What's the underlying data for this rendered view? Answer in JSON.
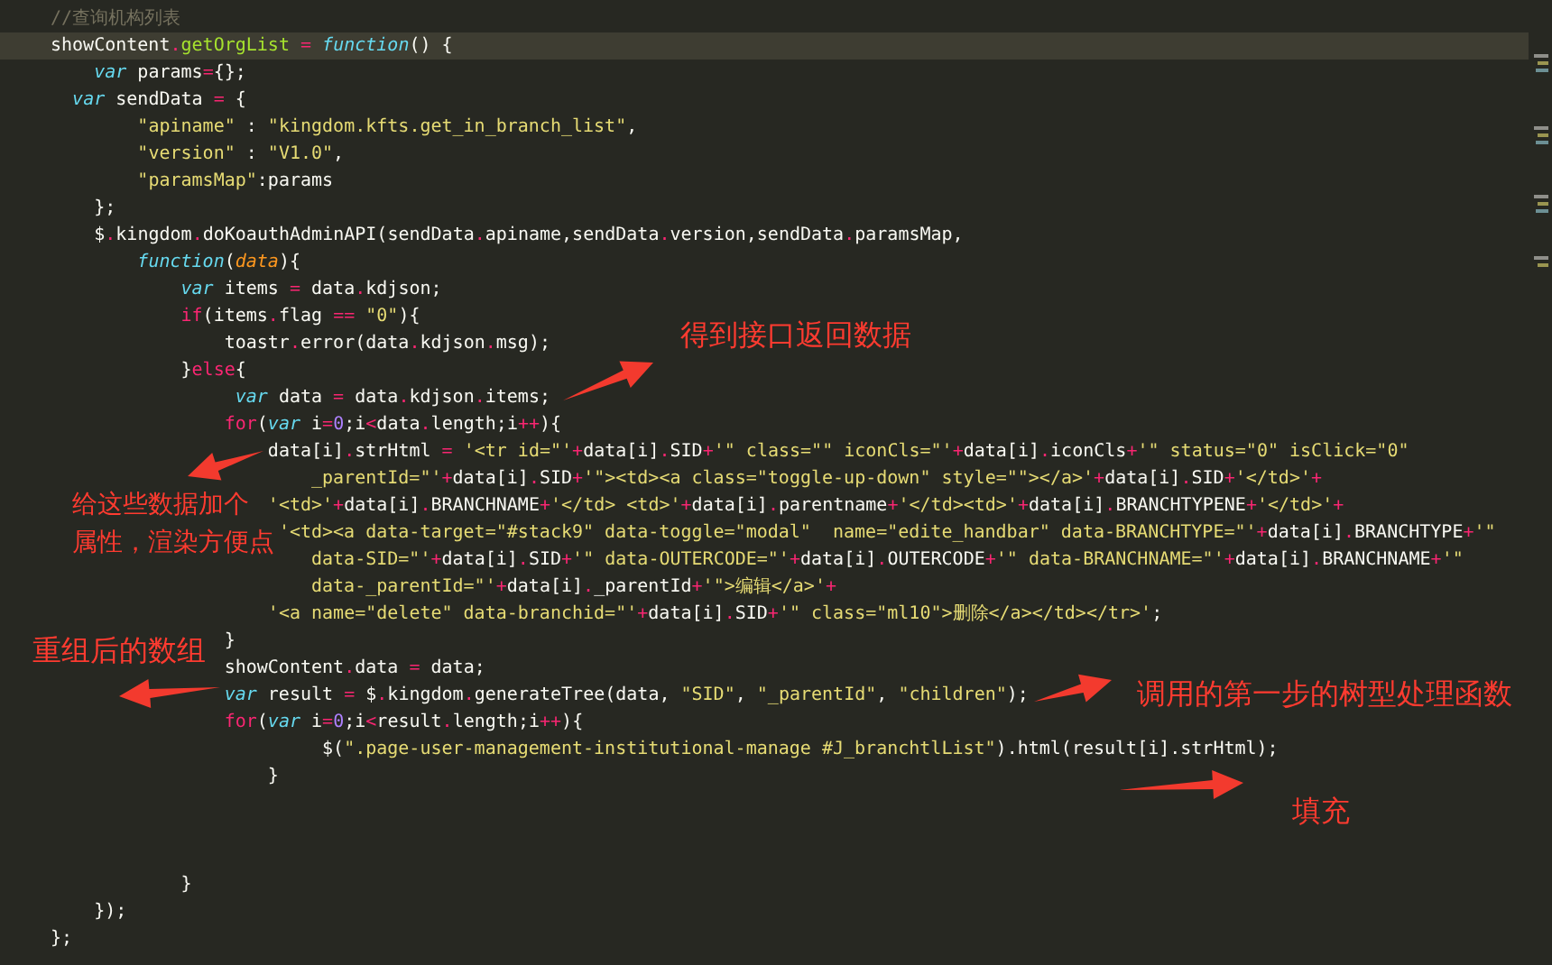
{
  "editor": {
    "lines": [
      {
        "current": false,
        "tokens": [
          {
            "kind": "comment",
            "text": "//查询机构列表"
          }
        ]
      },
      {
        "current": true,
        "tokens": [
          {
            "kind": "plain",
            "text": "showContent"
          },
          {
            "kind": "op",
            "text": "."
          },
          {
            "kind": "func",
            "text": "getOrgList"
          },
          {
            "kind": "op",
            "text": " = "
          },
          {
            "kind": "storage",
            "text": "function"
          },
          {
            "kind": "plain",
            "text": "() {"
          }
        ]
      },
      {
        "current": false,
        "tokens": [
          {
            "kind": "storage",
            "text": "    var"
          },
          {
            "kind": "plain",
            "text": " params"
          },
          {
            "kind": "op",
            "text": "="
          },
          {
            "kind": "plain",
            "text": "{};"
          }
        ]
      },
      {
        "current": false,
        "tokens": [
          {
            "kind": "storage",
            "text": "  var"
          },
          {
            "kind": "plain",
            "text": " sendData "
          },
          {
            "kind": "op",
            "text": "="
          },
          {
            "kind": "plain",
            "text": " {"
          }
        ]
      },
      {
        "current": false,
        "tokens": [
          {
            "kind": "string",
            "text": "        \"apiname\""
          },
          {
            "kind": "plain",
            "text": " : "
          },
          {
            "kind": "string",
            "text": "\"kingdom.kfts.get_in_branch_list\""
          },
          {
            "kind": "plain",
            "text": ","
          }
        ]
      },
      {
        "current": false,
        "tokens": [
          {
            "kind": "string",
            "text": "        \"version\""
          },
          {
            "kind": "plain",
            "text": " : "
          },
          {
            "kind": "string",
            "text": "\"V1.0\""
          },
          {
            "kind": "plain",
            "text": ","
          }
        ]
      },
      {
        "current": false,
        "tokens": [
          {
            "kind": "string",
            "text": "        \"paramsMap\""
          },
          {
            "kind": "plain",
            "text": ":params"
          }
        ]
      },
      {
        "current": false,
        "tokens": [
          {
            "kind": "plain",
            "text": "    };"
          }
        ]
      },
      {
        "current": false,
        "tokens": [
          {
            "kind": "plain",
            "text": "    $"
          },
          {
            "kind": "op",
            "text": "."
          },
          {
            "kind": "plain",
            "text": "kingdom"
          },
          {
            "kind": "op",
            "text": "."
          },
          {
            "kind": "plain",
            "text": "doKoauthAdminAPI(sendData"
          },
          {
            "kind": "op",
            "text": "."
          },
          {
            "kind": "plain",
            "text": "apiname,sendData"
          },
          {
            "kind": "op",
            "text": "."
          },
          {
            "kind": "plain",
            "text": "version,sendData"
          },
          {
            "kind": "op",
            "text": "."
          },
          {
            "kind": "plain",
            "text": "paramsMap,"
          }
        ]
      },
      {
        "current": false,
        "tokens": [
          {
            "kind": "storage",
            "text": "        function"
          },
          {
            "kind": "plain",
            "text": "("
          },
          {
            "kind": "param",
            "text": "data"
          },
          {
            "kind": "plain",
            "text": "){"
          }
        ]
      },
      {
        "current": false,
        "tokens": [
          {
            "kind": "storage",
            "text": "            var"
          },
          {
            "kind": "plain",
            "text": " items "
          },
          {
            "kind": "op",
            "text": "="
          },
          {
            "kind": "plain",
            "text": " data"
          },
          {
            "kind": "op",
            "text": "."
          },
          {
            "kind": "plain",
            "text": "kdjson;"
          }
        ]
      },
      {
        "current": false,
        "tokens": [
          {
            "kind": "keyword",
            "text": "            if"
          },
          {
            "kind": "plain",
            "text": "(items"
          },
          {
            "kind": "op",
            "text": "."
          },
          {
            "kind": "plain",
            "text": "flag "
          },
          {
            "kind": "op",
            "text": "== "
          },
          {
            "kind": "string",
            "text": "\"0\""
          },
          {
            "kind": "plain",
            "text": "){"
          }
        ]
      },
      {
        "current": false,
        "tokens": [
          {
            "kind": "plain",
            "text": "                toastr"
          },
          {
            "kind": "op",
            "text": "."
          },
          {
            "kind": "plain",
            "text": "error(data"
          },
          {
            "kind": "op",
            "text": "."
          },
          {
            "kind": "plain",
            "text": "kdjson"
          },
          {
            "kind": "op",
            "text": "."
          },
          {
            "kind": "plain",
            "text": "msg);"
          }
        ]
      },
      {
        "current": false,
        "tokens": [
          {
            "kind": "plain",
            "text": "            }"
          },
          {
            "kind": "keyword",
            "text": "else"
          },
          {
            "kind": "plain",
            "text": "{"
          }
        ]
      },
      {
        "current": false,
        "tokens": [
          {
            "kind": "storage",
            "text": "                 var"
          },
          {
            "kind": "plain",
            "text": " data "
          },
          {
            "kind": "op",
            "text": "="
          },
          {
            "kind": "plain",
            "text": " data"
          },
          {
            "kind": "op",
            "text": "."
          },
          {
            "kind": "plain",
            "text": "kdjson"
          },
          {
            "kind": "op",
            "text": "."
          },
          {
            "kind": "plain",
            "text": "items;"
          }
        ]
      },
      {
        "current": false,
        "tokens": [
          {
            "kind": "keyword",
            "text": "                for"
          },
          {
            "kind": "plain",
            "text": "("
          },
          {
            "kind": "storage",
            "text": "var"
          },
          {
            "kind": "plain",
            "text": " i"
          },
          {
            "kind": "op",
            "text": "="
          },
          {
            "kind": "number",
            "text": "0"
          },
          {
            "kind": "plain",
            "text": ";i"
          },
          {
            "kind": "op",
            "text": "<"
          },
          {
            "kind": "plain",
            "text": "data"
          },
          {
            "kind": "op",
            "text": "."
          },
          {
            "kind": "plain",
            "text": "length;i"
          },
          {
            "kind": "op",
            "text": "++"
          },
          {
            "kind": "plain",
            "text": "){"
          }
        ]
      },
      {
        "current": false,
        "tokens": [
          {
            "kind": "plain",
            "text": "                    data[i]"
          },
          {
            "kind": "op",
            "text": "."
          },
          {
            "kind": "plain",
            "text": "strHtml "
          },
          {
            "kind": "op",
            "text": "= "
          },
          {
            "kind": "string",
            "text": "'<tr id=\"'"
          },
          {
            "kind": "op",
            "text": "+"
          },
          {
            "kind": "plain",
            "text": "data[i]"
          },
          {
            "kind": "op",
            "text": "."
          },
          {
            "kind": "plain",
            "text": "SID"
          },
          {
            "kind": "op",
            "text": "+"
          },
          {
            "kind": "string",
            "text": "'\" class=\"\" iconCls=\"'"
          },
          {
            "kind": "op",
            "text": "+"
          },
          {
            "kind": "plain",
            "text": "data[i]"
          },
          {
            "kind": "op",
            "text": "."
          },
          {
            "kind": "plain",
            "text": "iconCls"
          },
          {
            "kind": "op",
            "text": "+"
          },
          {
            "kind": "string",
            "text": "'\" status=\"0\" isClick=\"0\""
          }
        ]
      },
      {
        "current": false,
        "tokens": [
          {
            "kind": "string",
            "text": "                        _parentId=\"'"
          },
          {
            "kind": "op",
            "text": "+"
          },
          {
            "kind": "plain",
            "text": "data[i]"
          },
          {
            "kind": "op",
            "text": "."
          },
          {
            "kind": "plain",
            "text": "SID"
          },
          {
            "kind": "op",
            "text": "+"
          },
          {
            "kind": "string",
            "text": "'\"><td><a class=\"toggle-up-down\" style=\"\"></a>'"
          },
          {
            "kind": "op",
            "text": "+"
          },
          {
            "kind": "plain",
            "text": "data[i]"
          },
          {
            "kind": "op",
            "text": "."
          },
          {
            "kind": "plain",
            "text": "SID"
          },
          {
            "kind": "op",
            "text": "+"
          },
          {
            "kind": "string",
            "text": "'</td>'"
          },
          {
            "kind": "op",
            "text": "+"
          }
        ]
      },
      {
        "current": false,
        "tokens": [
          {
            "kind": "string",
            "text": "                    '<td>'"
          },
          {
            "kind": "op",
            "text": "+"
          },
          {
            "kind": "plain",
            "text": "data[i]"
          },
          {
            "kind": "op",
            "text": "."
          },
          {
            "kind": "plain",
            "text": "BRANCHNAME"
          },
          {
            "kind": "op",
            "text": "+"
          },
          {
            "kind": "string",
            "text": "'</td> <td>'"
          },
          {
            "kind": "op",
            "text": "+"
          },
          {
            "kind": "plain",
            "text": "data[i]"
          },
          {
            "kind": "op",
            "text": "."
          },
          {
            "kind": "plain",
            "text": "parentname"
          },
          {
            "kind": "op",
            "text": "+"
          },
          {
            "kind": "string",
            "text": "'</td><td>'"
          },
          {
            "kind": "op",
            "text": "+"
          },
          {
            "kind": "plain",
            "text": "data[i]"
          },
          {
            "kind": "op",
            "text": "."
          },
          {
            "kind": "plain",
            "text": "BRANCHTYPENE"
          },
          {
            "kind": "op",
            "text": "+"
          },
          {
            "kind": "string",
            "text": "'</td>'"
          },
          {
            "kind": "op",
            "text": "+"
          }
        ]
      },
      {
        "current": false,
        "tokens": [
          {
            "kind": "string",
            "text": "                     '<td><a data-target=\"#stack9\" data-toggle=\"modal\"  name=\"edite_handbar\" data-BRANCHTYPE=\"'"
          },
          {
            "kind": "op",
            "text": "+"
          },
          {
            "kind": "plain",
            "text": "data[i]"
          },
          {
            "kind": "op",
            "text": "."
          },
          {
            "kind": "plain",
            "text": "BRANCHTYPE"
          },
          {
            "kind": "op",
            "text": "+"
          },
          {
            "kind": "string",
            "text": "'\""
          }
        ]
      },
      {
        "current": false,
        "tokens": [
          {
            "kind": "string",
            "text": "                        data-SID=\"'"
          },
          {
            "kind": "op",
            "text": "+"
          },
          {
            "kind": "plain",
            "text": "data[i]"
          },
          {
            "kind": "op",
            "text": "."
          },
          {
            "kind": "plain",
            "text": "SID"
          },
          {
            "kind": "op",
            "text": "+"
          },
          {
            "kind": "string",
            "text": "'\" data-OUTERCODE=\"'"
          },
          {
            "kind": "op",
            "text": "+"
          },
          {
            "kind": "plain",
            "text": "data[i]"
          },
          {
            "kind": "op",
            "text": "."
          },
          {
            "kind": "plain",
            "text": "OUTERCODE"
          },
          {
            "kind": "op",
            "text": "+"
          },
          {
            "kind": "string",
            "text": "'\" data-BRANCHNAME=\"'"
          },
          {
            "kind": "op",
            "text": "+"
          },
          {
            "kind": "plain",
            "text": "data[i]"
          },
          {
            "kind": "op",
            "text": "."
          },
          {
            "kind": "plain",
            "text": "BRANCHNAME"
          },
          {
            "kind": "op",
            "text": "+"
          },
          {
            "kind": "string",
            "text": "'\""
          }
        ]
      },
      {
        "current": false,
        "tokens": [
          {
            "kind": "string",
            "text": "                        data-_parentId=\"'"
          },
          {
            "kind": "op",
            "text": "+"
          },
          {
            "kind": "plain",
            "text": "data[i]"
          },
          {
            "kind": "op",
            "text": "."
          },
          {
            "kind": "plain",
            "text": "_parentId"
          },
          {
            "kind": "op",
            "text": "+"
          },
          {
            "kind": "string",
            "text": "'\">编辑</a>'"
          },
          {
            "kind": "op",
            "text": "+"
          }
        ]
      },
      {
        "current": false,
        "tokens": [
          {
            "kind": "string",
            "text": "                    '<a name=\"delete\" data-branchid=\"'"
          },
          {
            "kind": "op",
            "text": "+"
          },
          {
            "kind": "plain",
            "text": "data[i]"
          },
          {
            "kind": "op",
            "text": "."
          },
          {
            "kind": "plain",
            "text": "SID"
          },
          {
            "kind": "op",
            "text": "+"
          },
          {
            "kind": "string",
            "text": "'\" class=\"ml10\">删除</a></td></tr>'"
          },
          {
            "kind": "plain",
            "text": ";"
          }
        ]
      },
      {
        "current": false,
        "tokens": [
          {
            "kind": "plain",
            "text": "                }"
          }
        ]
      },
      {
        "current": false,
        "tokens": [
          {
            "kind": "plain",
            "text": "                showContent"
          },
          {
            "kind": "op",
            "text": "."
          },
          {
            "kind": "plain",
            "text": "data "
          },
          {
            "kind": "op",
            "text": "="
          },
          {
            "kind": "plain",
            "text": " data;"
          }
        ]
      },
      {
        "current": false,
        "tokens": [
          {
            "kind": "storage",
            "text": "                var"
          },
          {
            "kind": "plain",
            "text": " result "
          },
          {
            "kind": "op",
            "text": "="
          },
          {
            "kind": "plain",
            "text": " $"
          },
          {
            "kind": "op",
            "text": "."
          },
          {
            "kind": "plain",
            "text": "kingdom"
          },
          {
            "kind": "op",
            "text": "."
          },
          {
            "kind": "plain",
            "text": "generateTree(data, "
          },
          {
            "kind": "string",
            "text": "\"SID\""
          },
          {
            "kind": "plain",
            "text": ", "
          },
          {
            "kind": "string",
            "text": "\"_parentId\""
          },
          {
            "kind": "plain",
            "text": ", "
          },
          {
            "kind": "string",
            "text": "\"children\""
          },
          {
            "kind": "plain",
            "text": ");"
          }
        ]
      },
      {
        "current": false,
        "tokens": [
          {
            "kind": "keyword",
            "text": "                for"
          },
          {
            "kind": "plain",
            "text": "("
          },
          {
            "kind": "storage",
            "text": "var"
          },
          {
            "kind": "plain",
            "text": " i"
          },
          {
            "kind": "op",
            "text": "="
          },
          {
            "kind": "number",
            "text": "0"
          },
          {
            "kind": "plain",
            "text": ";i"
          },
          {
            "kind": "op",
            "text": "<"
          },
          {
            "kind": "plain",
            "text": "result"
          },
          {
            "kind": "op",
            "text": "."
          },
          {
            "kind": "plain",
            "text": "length;i"
          },
          {
            "kind": "op",
            "text": "++"
          },
          {
            "kind": "plain",
            "text": "){"
          }
        ]
      },
      {
        "current": false,
        "tokens": [
          {
            "kind": "plain",
            "text": "                         $("
          },
          {
            "kind": "string",
            "text": "\".page-user-management-institutional-manage #J_branchtlList\""
          },
          {
            "kind": "plain",
            "text": ").html(result[i].strHtml);"
          }
        ]
      },
      {
        "current": false,
        "tokens": [
          {
            "kind": "plain",
            "text": "                    }"
          }
        ]
      },
      {
        "current": false
      },
      {
        "current": false
      },
      {
        "current": false
      },
      {
        "current": false,
        "tokens": [
          {
            "kind": "plain",
            "text": "            }"
          }
        ]
      },
      {
        "current": false,
        "tokens": [
          {
            "kind": "plain",
            "text": "    });"
          }
        ]
      },
      {
        "current": false,
        "tokens": [
          {
            "kind": "plain",
            "text": "};"
          }
        ]
      }
    ]
  },
  "notes": [
    {
      "text": "得到接口返回数据"
    },
    {
      "text": "给这些数据加个"
    },
    {
      "text": "属性，渲染方便点"
    },
    {
      "text": "重组后的数组"
    },
    {
      "text": "调用的第一步的树型处理函数"
    },
    {
      "text": "填充"
    }
  ]
}
